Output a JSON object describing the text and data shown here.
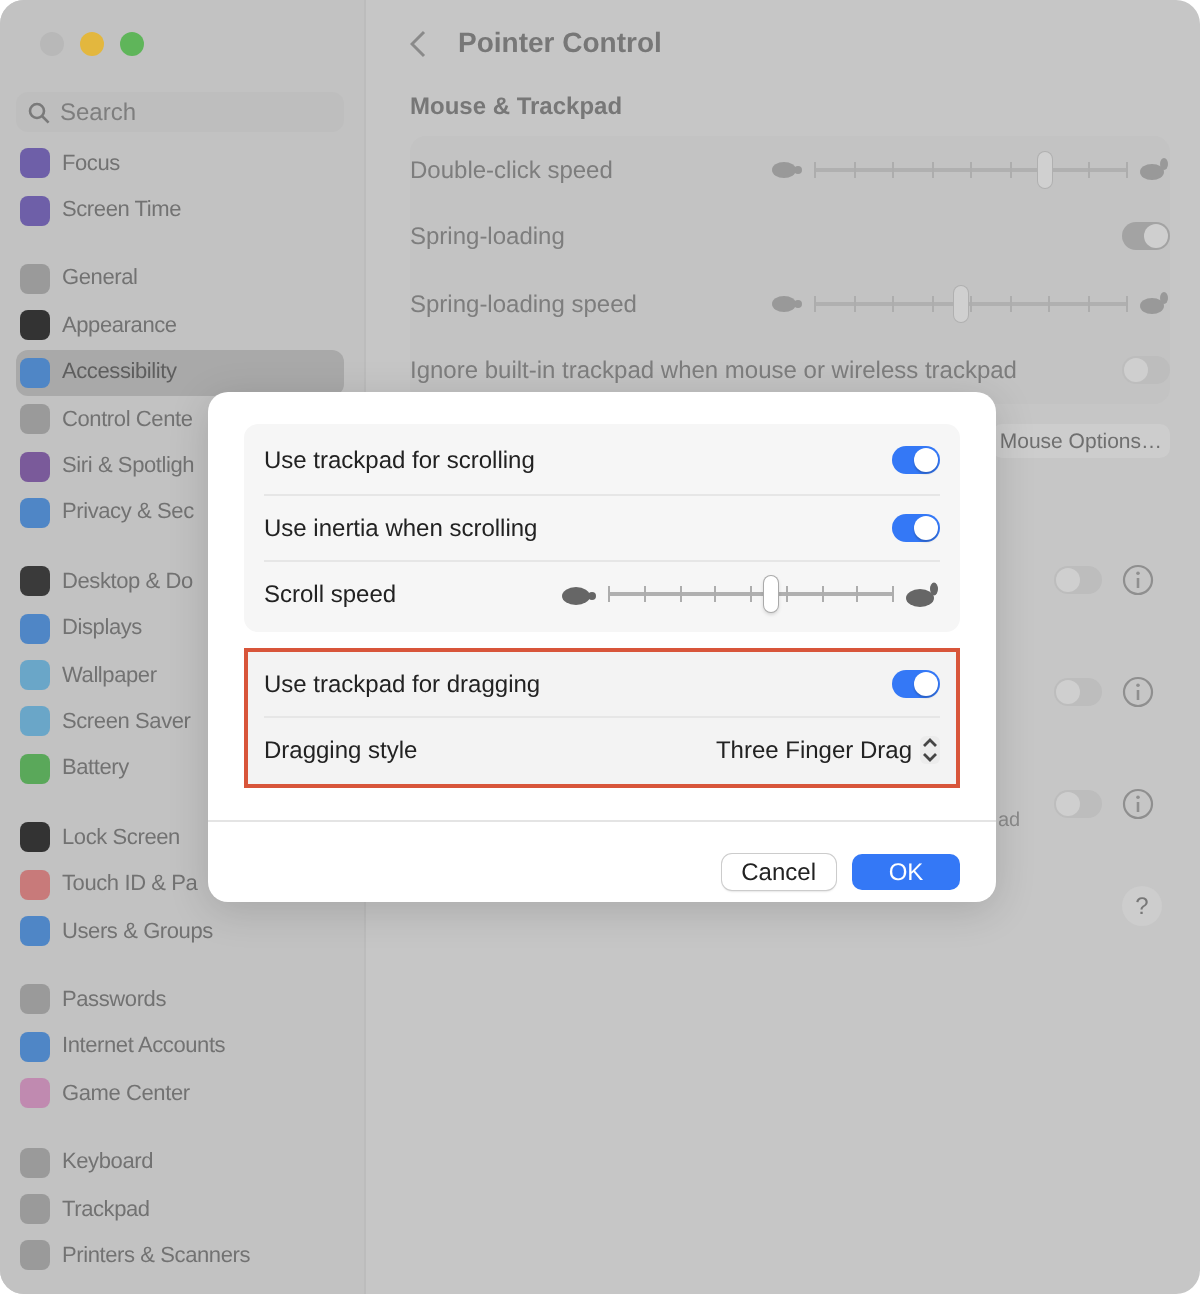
{
  "window": {
    "search": {
      "placeholder": "Search"
    }
  },
  "sidebar": {
    "groups": [
      {
        "items": [
          {
            "label": "Focus",
            "color": "#6e5fa8",
            "selected": false
          },
          {
            "label": "Screen Time",
            "color": "#6e5fa8",
            "selected": false
          }
        ]
      },
      {
        "items": [
          {
            "label": "General",
            "color": "#9a9a9a",
            "selected": false
          },
          {
            "label": "Appearance",
            "color": "#333333",
            "selected": false
          },
          {
            "label": "Accessibility",
            "color": "#4f86c6",
            "selected": true
          },
          {
            "label": "Control Cente",
            "color": "#9a9a9a",
            "selected": false
          },
          {
            "label": "Siri & Spotligh",
            "color": "#7a5a9a",
            "selected": false
          },
          {
            "label": "Privacy & Sec",
            "color": "#4f86c6",
            "selected": false
          }
        ]
      },
      {
        "items": [
          {
            "label": "Desktop & Do",
            "color": "#3a3a3a",
            "selected": false
          },
          {
            "label": "Displays",
            "color": "#4f86c6",
            "selected": false
          },
          {
            "label": "Wallpaper",
            "color": "#6aa6c8",
            "selected": false
          },
          {
            "label": "Screen Saver",
            "color": "#6aa6c8",
            "selected": false
          },
          {
            "label": "Battery",
            "color": "#5aa85a",
            "selected": false
          }
        ]
      },
      {
        "items": [
          {
            "label": "Lock Screen",
            "color": "#333333",
            "selected": false
          },
          {
            "label": "Touch ID & Pa",
            "color": "#c87a7a",
            "selected": false
          },
          {
            "label": "Users & Groups",
            "color": "#4f86c6",
            "selected": false
          }
        ]
      },
      {
        "items": [
          {
            "label": "Passwords",
            "color": "#9a9a9a",
            "selected": false
          },
          {
            "label": "Internet Accounts",
            "color": "#4f86c6",
            "selected": false
          },
          {
            "label": "Game Center",
            "color": "#c08ab0",
            "selected": false
          }
        ]
      },
      {
        "items": [
          {
            "label": "Keyboard",
            "color": "#9a9a9a",
            "selected": false
          },
          {
            "label": "Trackpad",
            "color": "#9a9a9a",
            "selected": false
          },
          {
            "label": "Printers & Scanners",
            "color": "#9a9a9a",
            "selected": false
          }
        ]
      }
    ]
  },
  "main": {
    "title": "Pointer Control",
    "section": "Mouse & Trackpad",
    "rows": [
      {
        "kind": "slider",
        "label": "Double-click speed",
        "level": 0.74
      },
      {
        "kind": "toggle",
        "label": "Spring-loading",
        "on": true
      },
      {
        "kind": "slider",
        "label": "Spring-loading speed",
        "level": 0.47
      },
      {
        "kind": "toggle",
        "label": "Ignore built-in trackpad when mouse or wireless trackpad",
        "on": false
      }
    ],
    "options_button": "Mouse Options…",
    "more_rows": [
      {
        "on": false
      },
      {
        "on": false
      },
      {
        "on": false,
        "note": "ad"
      }
    ],
    "help": "?"
  },
  "dialog": {
    "groups": [
      {
        "highlighted": false,
        "rows": [
          {
            "kind": "toggle",
            "label": "Use trackpad for scrolling",
            "on": true
          },
          {
            "kind": "toggle",
            "label": "Use inertia when scrolling",
            "on": true
          },
          {
            "kind": "slider",
            "label": "Scroll speed",
            "level": 0.57
          }
        ]
      },
      {
        "highlighted": true,
        "rows": [
          {
            "kind": "toggle",
            "label": "Use trackpad for dragging",
            "on": true
          },
          {
            "kind": "popup",
            "label": "Dragging style",
            "value": "Three Finger Drag"
          }
        ]
      }
    ],
    "buttons": [
      "Cancel",
      "OK"
    ]
  }
}
